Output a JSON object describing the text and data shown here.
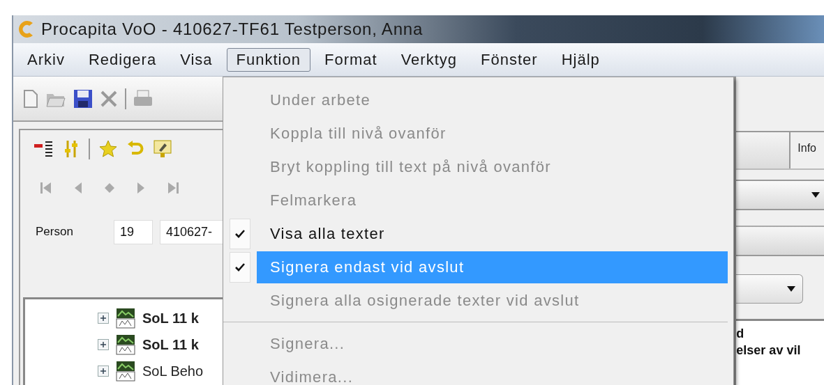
{
  "window": {
    "title": "Procapita VoO - 410627-TF61 Testperson, Anna"
  },
  "menu_bar": [
    {
      "label": "Arkiv",
      "selected": false
    },
    {
      "label": "Redigera",
      "selected": false
    },
    {
      "label": "Visa",
      "selected": false
    },
    {
      "label": "Funktion",
      "selected": true
    },
    {
      "label": "Format",
      "selected": false
    },
    {
      "label": "Verktyg",
      "selected": false
    },
    {
      "label": "Fönster",
      "selected": false
    },
    {
      "label": "Hjälp",
      "selected": false
    }
  ],
  "dropdown": [
    {
      "kind": "item",
      "label": "Under arbete",
      "disabled": true,
      "checked": false,
      "selected": false
    },
    {
      "kind": "item",
      "label": "Koppla till nivå ovanför",
      "disabled": true,
      "checked": false,
      "selected": false
    },
    {
      "kind": "item",
      "label": "Bryt koppling till text på nivå ovanför",
      "disabled": true,
      "checked": false,
      "selected": false
    },
    {
      "kind": "item",
      "label": "Felmarkera",
      "disabled": true,
      "checked": false,
      "selected": false
    },
    {
      "kind": "item",
      "label": "Visa alla texter",
      "disabled": false,
      "checked": true,
      "selected": false
    },
    {
      "kind": "item",
      "label": "Signera endast vid avslut",
      "disabled": false,
      "checked": true,
      "selected": true
    },
    {
      "kind": "item",
      "label": "Signera alla osignerade texter vid avslut",
      "disabled": true,
      "checked": false,
      "selected": false
    },
    {
      "kind": "separator"
    },
    {
      "kind": "item",
      "label": "Signera...",
      "disabled": true,
      "checked": false,
      "selected": false
    },
    {
      "kind": "item",
      "label": "Vidimera...",
      "disabled": true,
      "checked": false,
      "selected": false
    }
  ],
  "person": {
    "label": "Person",
    "century": "19",
    "number": "410627-"
  },
  "tree": [
    {
      "label": "SoL 11 k",
      "bold": true,
      "expanded": false
    },
    {
      "label": "SoL 11 k",
      "bold": true,
      "expanded": false
    },
    {
      "label": "SoL Beho",
      "bold": false,
      "expanded": false
    }
  ],
  "right_panel": {
    "tab": "Info",
    "lines": [
      "d",
      "elser av vil"
    ]
  }
}
